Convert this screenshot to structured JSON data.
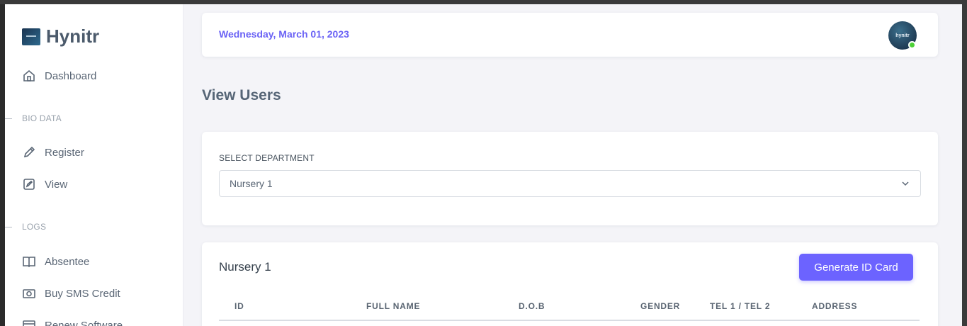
{
  "brand": {
    "name": "Hynitr",
    "logo_text": "hynitr"
  },
  "sidebar": {
    "items": [
      {
        "label": "Dashboard",
        "icon": "home-icon"
      },
      {
        "label": "Register",
        "icon": "pencil-icon"
      },
      {
        "label": "View",
        "icon": "edit-square-icon"
      },
      {
        "label": "Absentee",
        "icon": "book-icon"
      },
      {
        "label": "Buy SMS Credit",
        "icon": "camera-icon"
      },
      {
        "label": "Renew Software",
        "icon": "card-icon"
      }
    ],
    "sections": [
      "BIO DATA",
      "LOGS"
    ]
  },
  "header": {
    "date": "Wednesday, March 01, 2023",
    "avatar_text": "hynitr"
  },
  "page": {
    "title": "View Users"
  },
  "filter": {
    "label": "SELECT DEPARTMENT",
    "selected": "Nursery 1"
  },
  "list": {
    "title": "Nursery 1",
    "button": "Generate ID Card",
    "columns": [
      "ID",
      "FULL NAME",
      "D.O.B",
      "GENDER",
      "TEL 1 / TEL 2",
      "ADDRESS"
    ]
  },
  "colors": {
    "accent": "#6c63ff",
    "date_text": "#6b63f5",
    "online": "#4cd137"
  }
}
